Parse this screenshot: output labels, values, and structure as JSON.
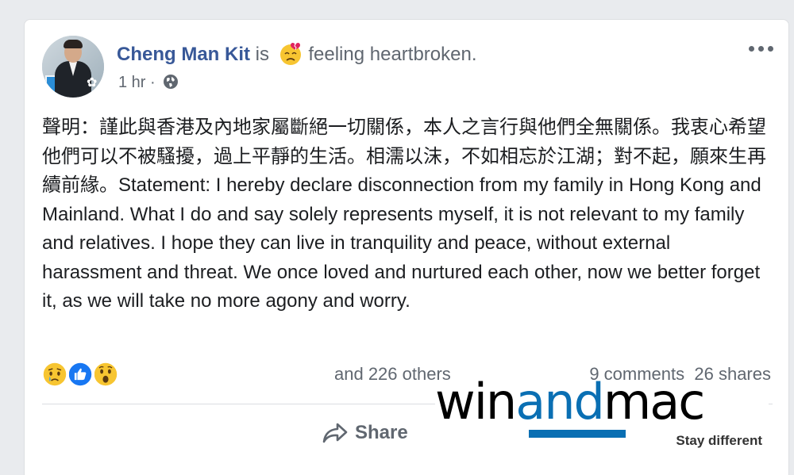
{
  "post": {
    "author": "Cheng Man Kit",
    "connector": "is",
    "feeling_icon": "heartbroken-face-emoji",
    "feeling_text": "feeling heartbroken.",
    "time": "1 hr",
    "separator": "·",
    "privacy_icon": "globe-icon",
    "text": "聲明：謹此與香港及內地家屬斷絕一切關係，本人之言行與他們全無關係。我衷心希望他們可以不被騷擾，過上平靜的生活。相濡以沫，不如相忘於江湖；對不起，願來生再續前緣。Statement: I hereby declare disconnection from my family in Hong Kong and Mainland. What I do and say solely represents myself, it is not relevant to my family and relatives. I hope they can live in tranquility and peace, without external harassment and threat. We once loved and nurtured each other, now we better forget it, as we will take no more agony and worry."
  },
  "reactions": {
    "icons": [
      "sad-reaction-icon",
      "like-reaction-icon",
      "wow-reaction-icon"
    ],
    "others_text": "and 226 others",
    "comments": "9 comments",
    "shares": "26 shares"
  },
  "actions": {
    "share_label": "Share"
  },
  "watermark": {
    "brand_prefix": "win",
    "brand_mid": "and",
    "brand_suffix": "mac",
    "tagline": "Stay different",
    "accent_color": "#0a6fb3"
  },
  "colors": {
    "author_link": "#385898",
    "secondary_text": "#606770",
    "body_text": "#1c1e21",
    "like_blue": "#1877f2"
  }
}
